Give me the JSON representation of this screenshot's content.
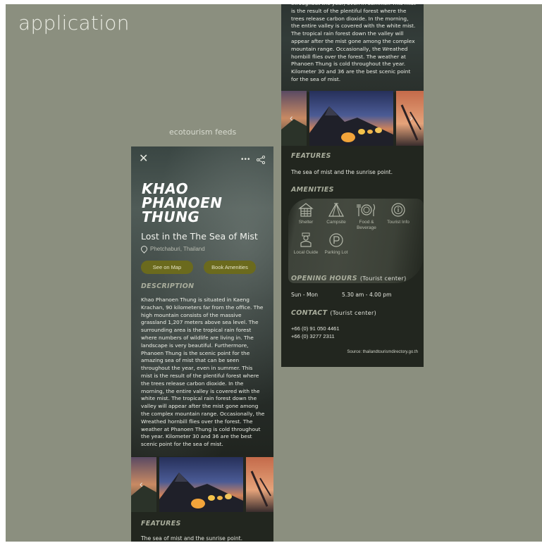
{
  "app_title": "application",
  "feeds_label": "ecotourism feeds",
  "screen1": {
    "title_lines": [
      "KHAO",
      "PHANOEN",
      "THUNG"
    ],
    "subtitle": "Lost in the The Sea of Mist",
    "location": "Phetchaburi, Thailand",
    "buttons": {
      "map": "See on Map",
      "amenities": "Book Amenities"
    },
    "description_heading": "DESCRIPTION",
    "description": "Khao Phanoen Thung is situated in Kaeng Krachan, 90 kilometers far from the office. The high mountain consists of the massive grassland 1,207 meters above sea level. The surrounding area is the tropical rain forest where numbers of wildlife are living in. The landscape is very beautiful. Furthermore, Phanoen Thung is the scenic point for the amazing sea of mist that can be seen throughout the year, even in summer. This mist is the result of the plentiful forest where the trees release carbon dioxide. In the morning, the entire valley is covered with the white mist. The tropical rain forest down the valley will appear after the mist gone among the complex mountain range. Occasionally, the Wreathed hornbill flies over the forest. The weather at Phanoen Thung is cold throughout the year. Kilometer 30 and 36 are the best scenic point for the sea of mist.",
    "features_heading": "FEATURES",
    "features_text": "The sea of mist and the sunrise point."
  },
  "screen2": {
    "description_tail": "throughout the year, even in summer. This mist is the result of the plentiful forest where the trees release carbon dioxide. In the morning, the entire valley is covered with the white mist. The tropical rain forest down the valley will appear after the mist gone among the complex mountain range. Occasionally, the Wreathed hornbill flies over the forest. The weather at Phanoen Thung is cold throughout the year. Kilometer 30 and 36 are the best scenic point for the sea of mist.",
    "features_heading": "FEATURES",
    "features_text": "The sea of mist and the sunrise point.",
    "amenities_heading": "AMENITIES",
    "amenities": [
      {
        "label": "Shelter",
        "icon": "shelter-icon"
      },
      {
        "label": "Campsite",
        "icon": "tent-icon"
      },
      {
        "label": "Food & Beverage",
        "icon": "food-icon"
      },
      {
        "label": "Tourist Info",
        "icon": "info-icon"
      },
      {
        "label": "Local Guide",
        "icon": "guide-icon"
      },
      {
        "label": "Parking Lot",
        "icon": "parking-icon"
      }
    ],
    "opening_heading": "OPENING HOURS",
    "opening_note": "(Tourist center)",
    "hours_days": "Sun - Mon",
    "hours_time": "5.30 am - 4.00 pm",
    "contact_heading": "CONTACT",
    "contact_note": "(Tourist center)",
    "phones": [
      "+66 (0) 91 050 4461",
      "+66 (0) 3277 2311"
    ],
    "source": "Source: thailandtourismdirectory.go.th"
  },
  "colors": {
    "background": "#8b8f7f",
    "screen": "#22261f",
    "button": "#6b6a1d",
    "heading": "#a9ad9c"
  }
}
